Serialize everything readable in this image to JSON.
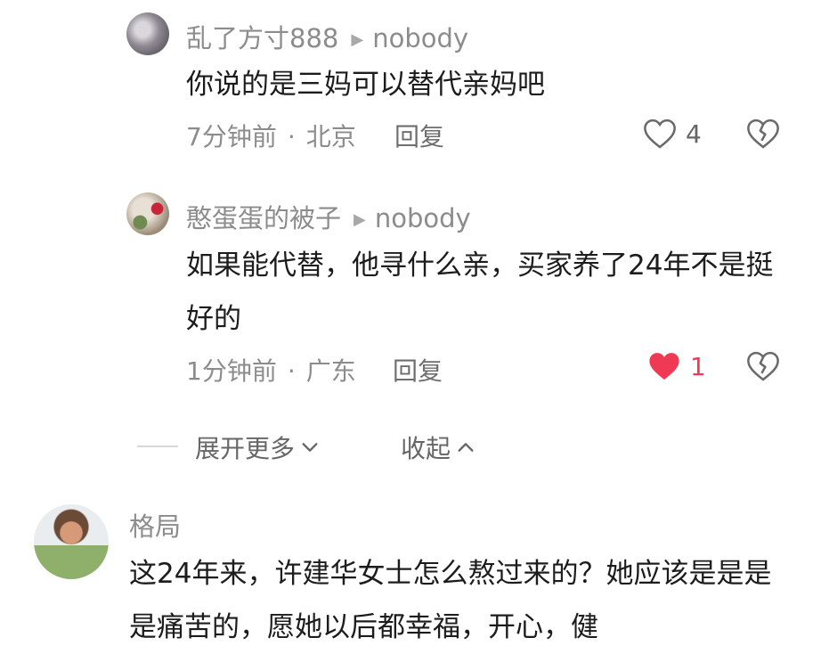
{
  "comments": [
    {
      "author": "乱了方寸888",
      "reply_to": "nobody",
      "text": "你说的是三妈可以替代亲妈吧",
      "time": "7分钟前",
      "location": "北京",
      "reply_label": "回复",
      "likes": "4",
      "liked": false
    },
    {
      "author": "憨蛋蛋的被子",
      "reply_to": "nobody",
      "text": "如果能代替，他寻什么亲，买家养了24年不是挺好的",
      "time": "1分钟前",
      "location": "广东",
      "reply_label": "回复",
      "likes": "1",
      "liked": true
    }
  ],
  "expand_more_label": "展开更多",
  "collapse_label": "收起",
  "top_comment": {
    "author": "格局",
    "text": "这24年来，许建华女士怎么熬过来的？她应该是是是是痛苦的，愿她以后都幸福，开心，健"
  },
  "colors": {
    "liked_red": "#f03a55",
    "meta_gray": "#8c8c8c"
  },
  "icons": {
    "like": "heart-outline-icon",
    "liked": "heart-filled-icon",
    "dislike": "broken-heart-icon",
    "expand": "chevron-down-icon",
    "collapse": "chevron-up-icon"
  }
}
